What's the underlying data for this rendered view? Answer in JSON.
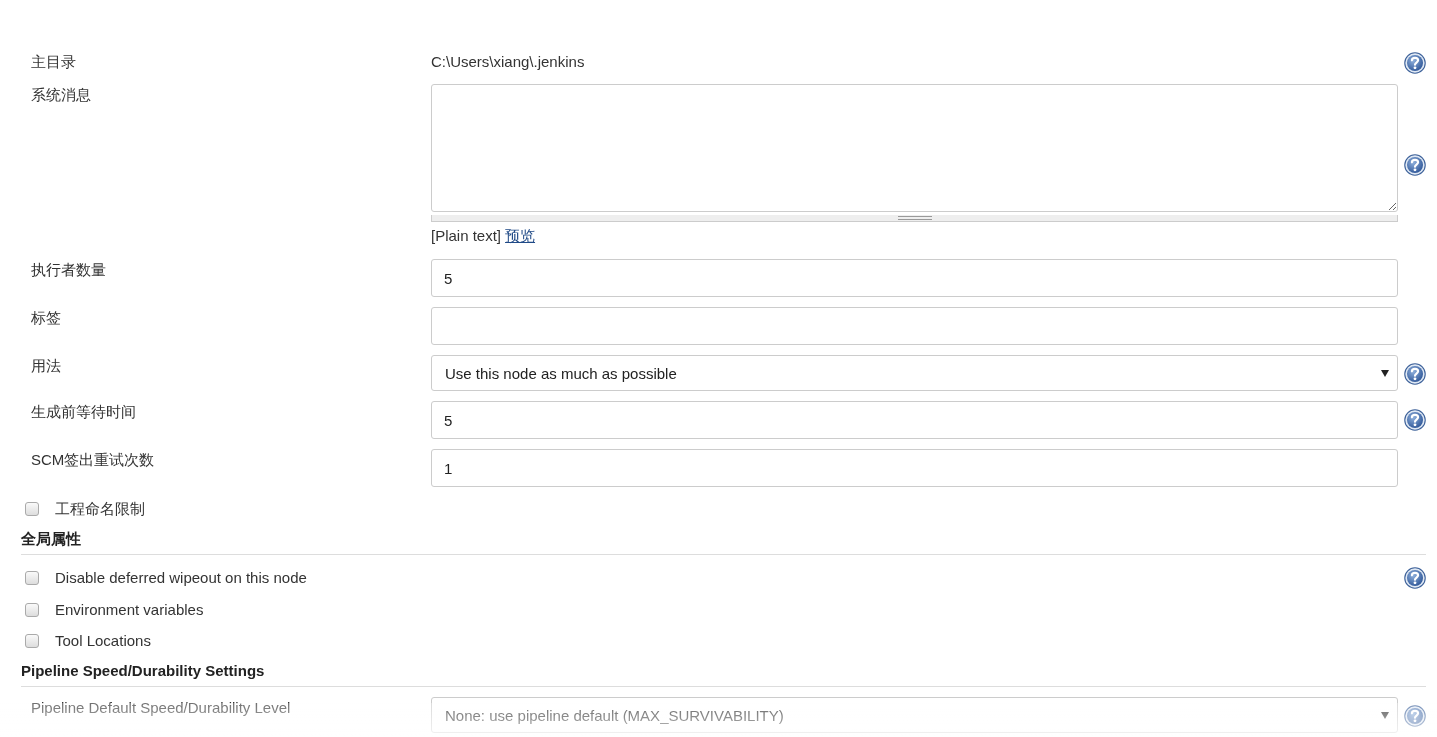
{
  "rows": [
    {
      "kind": "static",
      "label": "主目录",
      "value": "C:\\Users\\xiang\\.jenkins",
      "help": true
    },
    {
      "kind": "textarea",
      "label": "系统消息",
      "value": "",
      "help": true,
      "format": "[Plain text]",
      "link": "预览"
    },
    {
      "kind": "input",
      "label": "执行者数量",
      "value": "5",
      "help": false
    },
    {
      "kind": "input",
      "label": "标签",
      "value": "",
      "help": false
    },
    {
      "kind": "select",
      "label": "用法",
      "value": "Use this node as much as possible",
      "help": true
    },
    {
      "kind": "input",
      "label": "生成前等待时间",
      "value": "5",
      "help": true
    },
    {
      "kind": "input",
      "label": "SCM签出重试次数",
      "value": "1",
      "help": false
    },
    {
      "kind": "checkbox",
      "label": "工程命名限制",
      "checked": false,
      "help": false
    },
    {
      "kind": "section",
      "label": "全局属性"
    },
    {
      "kind": "checkbox",
      "label": "Disable deferred wipeout on this node",
      "checked": false,
      "help": true
    },
    {
      "kind": "checkbox",
      "label": "Environment variables",
      "checked": false,
      "help": false
    },
    {
      "kind": "checkbox",
      "label": "Tool Locations",
      "checked": false,
      "help": false
    },
    {
      "kind": "section",
      "label": "Pipeline Speed/Durability Settings"
    },
    {
      "kind": "select",
      "label": "Pipeline Default Speed/Durability Level",
      "value": "None: use pipeline default (MAX_SURVIVABILITY)",
      "help": true
    }
  ]
}
